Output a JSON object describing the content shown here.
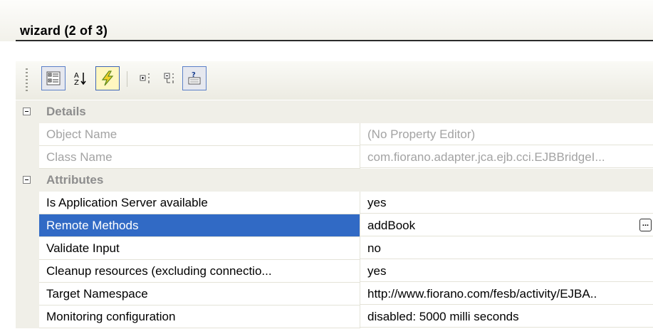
{
  "panel": {
    "title": "wizard (2 of 3)"
  },
  "toolbar": {
    "buttons": [
      {
        "icon": "categorized-view-icon",
        "state": "active"
      },
      {
        "icon": "sort-alphabetical-icon",
        "state": "normal"
      },
      {
        "icon": "events-lightning-icon",
        "state": "pressed"
      },
      {
        "icon": "expand-all-icon",
        "state": "normal"
      },
      {
        "icon": "collapse-all-icon",
        "state": "normal"
      },
      {
        "icon": "property-help-icon",
        "state": "active"
      }
    ]
  },
  "grid": {
    "categories": [
      {
        "label": "Details",
        "rows": [
          {
            "name": "Object Name",
            "value": "(No Property Editor)"
          },
          {
            "name": "Class Name",
            "value": "com.fiorano.adapter.jca.ejb.cci.EJBBridgeI..."
          }
        ]
      },
      {
        "label": "Attributes",
        "rows": [
          {
            "name": "Is Application Server available",
            "value": "yes"
          },
          {
            "name": "Remote Methods",
            "value": "addBook",
            "editor_button": "..."
          },
          {
            "name": "Validate Input",
            "value": "no"
          },
          {
            "name": "Cleanup resources (excluding connectio...",
            "value": "yes"
          },
          {
            "name": "Target Namespace",
            "value": "http://www.fiorano.com/fesb/activity/EJBA.."
          },
          {
            "name": "Monitoring configuration",
            "value": "disabled: 5000 milli seconds"
          }
        ]
      }
    ]
  },
  "colors": {
    "selection": "#316ac5",
    "category_bg": "#f0efe8",
    "readonly_text": "#a3a3a3"
  }
}
